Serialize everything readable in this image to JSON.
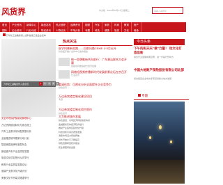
{
  "header": {
    "logo": "风货界",
    "info": "中文版 · 2024年05月14日 星期二",
    "search_placeholder": "请输入关键字"
  },
  "nav": [
    [
      "首页",
      "国际"
    ],
    [
      "产业资讯",
      "企业资讯"
    ],
    [
      "新闻中心",
      "行业动态"
    ],
    [
      "新品发布",
      "财经资讯"
    ],
    [
      "热点追踪",
      "人物访谈"
    ],
    [
      "品牌资讯",
      "市场分析"
    ],
    [
      "视频",
      "专题"
    ],
    [
      "汽车",
      "科技"
    ],
    [
      "家居",
      "健康"
    ],
    [
      "时尚",
      "旅游"
    ],
    [
      "教育",
      "文化"
    ],
    [
      "房产",
      "美食"
    ]
  ],
  "ticker": "万华化工战略新闻入选科技第三批企业名单",
  "slider": {
    "caption": "万华化工战略合作入选示范",
    "dots": [
      "1",
      "2",
      "3",
      "4",
      "5"
    ]
  },
  "hot": {
    "title": "热点关注",
    "items": [
      {
        "title": "医学科普新思路——目前风挽CEME 于5月召开",
        "sub": "综合医疗推广合作中心发布报告"
      },
      {
        "title": "统一思想聚新共向前行：广东潮汕联合大会开幕",
        "sub": "加强协同推进地方经济发展"
      },
      {
        "title": "网络短视频传播新时代发展前景论坛在京召开",
        "sub": "行业资讯"
      },
      {
        "title": "看清形势：可视化分析全面提升企业竞争力",
        "sub": "综合资讯"
      },
      {
        "title": "万达贵宾楼定制化建设项目",
        "sub": "专题"
      }
    ]
  },
  "today": {
    "title": "今日头条",
    "items": [
      {
        "title": "下午的彩天天“做”力量！ 动文化打造出新",
        "sub": "综合行业发展成果显著，进一步提升影响力"
      },
      {
        "title": "中国大地财产保险股份有限公司北部",
        "sub": "综合报道企业举办多项活动助力地方发展"
      }
    ]
  },
  "left_list": [
    "安全环境保护智能化管理中心",
    "万达贵宾楼定制化与综合施工",
    "汽车工业数字化转型发展分析",
    "全面推进城市更新行动计划",
    "智能家居品牌年度发布会",
    "新能源汽车产业高质量发展",
    "旅游文化项目签约仪式举行",
    "教育行业高质量发展论坛",
    "健康产业数字化升级计划",
    "美食文化节开幕式隆重举行"
  ],
  "mid": {
    "head1": "万达贵宾楼定制化项目签约",
    "sub1": "综合资讯",
    "head2": "大力推进城市发展",
    "rows": [
      "综合报道：市场经济持续恢复向好",
      "金融服务实体经济稳步提升",
      "推动产业链供应链优化升级",
      "科技创新引领高质量发展",
      "消费市场活力持续释放",
      "对外开放水平不断提高",
      "绿色低碳转型稳步推进",
      "民生保障持续加强"
    ]
  },
  "zhuanti": {
    "title": "专题"
  }
}
